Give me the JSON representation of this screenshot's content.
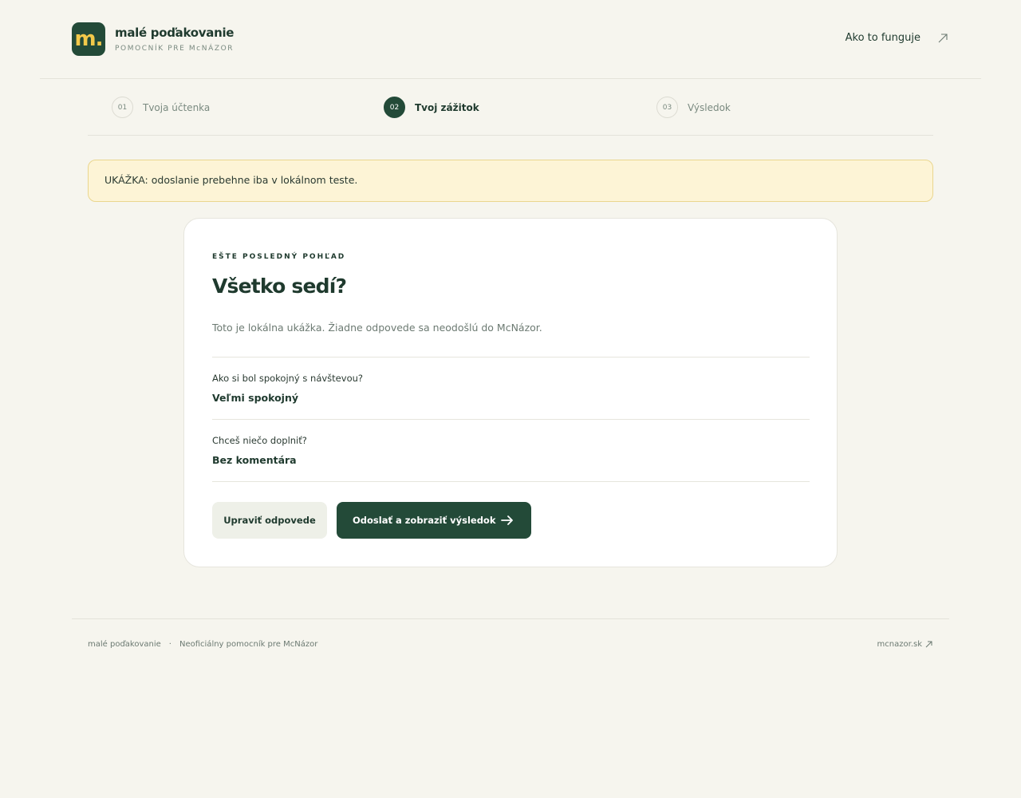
{
  "header": {
    "logo_text": "m.",
    "brand_title": "malé poďakovanie",
    "brand_subtitle": "POMOCNÍK PRE McNÁZOR",
    "how_link": "Ako to funguje"
  },
  "steps": [
    {
      "num": "01",
      "label": "Tvoja účtenka",
      "state": "done"
    },
    {
      "num": "02",
      "label": "Tvoj zážitok",
      "state": "active"
    },
    {
      "num": "03",
      "label": "Výsledok",
      "state": "upcoming"
    }
  ],
  "notice": {
    "text": "UKÁŽKA: odoslanie prebehne iba v lokálnom teste."
  },
  "card": {
    "eyebrow": "EŠTE POSLEDNÝ POHĽAD",
    "heading": "Všetko sedí?",
    "intro": "Toto je lokálna ukážka. Žiadne odpovede sa neodošlú do McNázor.",
    "answers": [
      {
        "question": "Ako si bol spokojný s návštevou?",
        "answer": "Veľmi spokojný"
      },
      {
        "question": "Chceš niečo doplniť?",
        "answer": "Bez komentára"
      }
    ],
    "edit_button": "Upraviť odpovede",
    "submit_button": "Odoslať a zobraziť výsledok"
  },
  "footer": {
    "brand": "malé poďakovanie",
    "separator": "·",
    "tagline": "Neoficiálny pomocník pre McNázor",
    "site_link": "mcnazor.sk"
  },
  "colors": {
    "background": "#f6f5ee",
    "primary": "#234a38",
    "logo_accent": "#f3c94a",
    "notice_bg": "#fdf4d6",
    "notice_border": "#ead68e"
  }
}
